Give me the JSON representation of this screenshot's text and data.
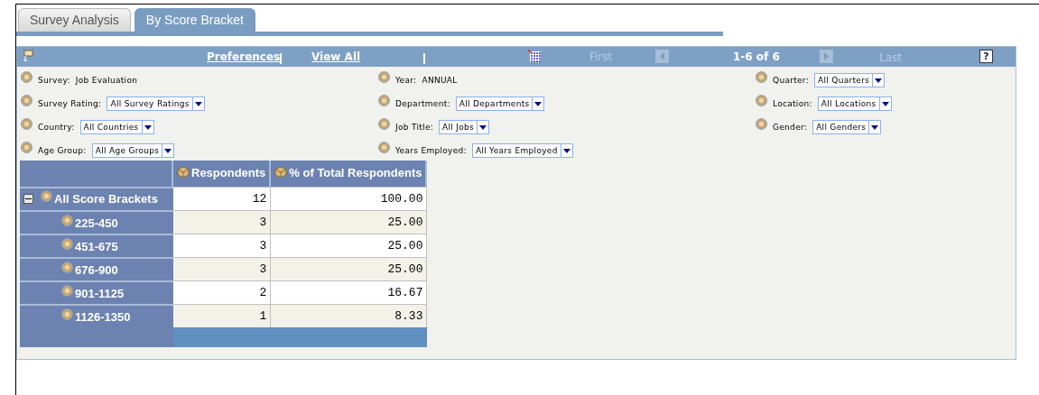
{
  "tabs": [
    {
      "label": "Survey Analysis",
      "selected": false
    },
    {
      "label": "By Score Bracket",
      "selected": true
    }
  ],
  "toolbar": {
    "links": [
      "Preferences",
      "View All"
    ],
    "first": {
      "label": "First",
      "disabled": true
    },
    "range": "1-6 of 6",
    "last": {
      "label": "Last",
      "disabled": true
    },
    "help": "?"
  },
  "filters": [
    [
      {
        "kind": "text",
        "label": "Survey:",
        "value": "Job Evaluation"
      },
      {
        "kind": "dropdown",
        "label": "Survey Rating:",
        "value": "All Survey Ratings"
      },
      {
        "kind": "dropdown",
        "label": "Country:",
        "value": "All Countries"
      },
      {
        "kind": "dropdown",
        "label": "Age Group:",
        "value": "All Age Groups"
      }
    ],
    [
      {
        "kind": "text",
        "label": "Year:",
        "value": "ANNUAL"
      },
      {
        "kind": "dropdown",
        "label": "Department:",
        "value": "All Departments"
      },
      {
        "kind": "dropdown",
        "label": "Job Title:",
        "value": "All Jobs"
      },
      {
        "kind": "dropdown",
        "label": "Years Employed:",
        "value": "All Years Employed"
      }
    ],
    [
      {
        "kind": "dropdown",
        "label": "Quarter:",
        "value": "All Quarters"
      },
      {
        "kind": "dropdown",
        "label": "Location:",
        "value": "All Locations"
      },
      {
        "kind": "dropdown",
        "label": "Gender:",
        "value": "All Genders"
      }
    ]
  ],
  "grid": {
    "columns": [
      "Respondents",
      "% of Total Respondents"
    ],
    "rows": [
      {
        "label": "All Score Brackets",
        "expanded": true,
        "values": [
          "12",
          "100.00"
        ],
        "children": [
          {
            "label": "225-450",
            "values": [
              "3",
              "25.00"
            ]
          },
          {
            "label": "451-675",
            "values": [
              "3",
              "25.00"
            ]
          },
          {
            "label": "676-900",
            "values": [
              "3",
              "25.00"
            ]
          },
          {
            "label": "901-1125",
            "values": [
              "2",
              "16.67"
            ]
          },
          {
            "label": "1126-1350",
            "values": [
              "1",
              "8.33"
            ]
          }
        ]
      }
    ]
  }
}
